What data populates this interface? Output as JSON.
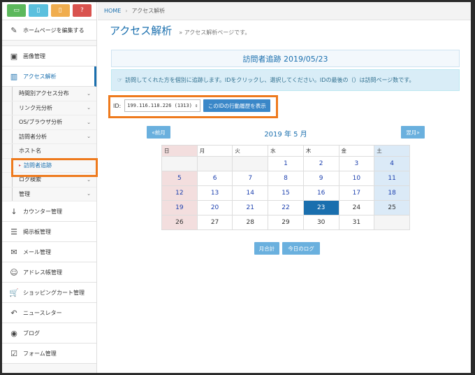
{
  "top_icons": [
    {
      "name": "monitor-icon",
      "glyph": "▭"
    },
    {
      "name": "tablet-icon",
      "glyph": "▯"
    },
    {
      "name": "phone-icon",
      "glyph": "▯"
    },
    {
      "name": "help-icon",
      "glyph": "?"
    }
  ],
  "sidebar": {
    "edit_home": {
      "label": "ホームページを編集する",
      "icon": "✎"
    },
    "image_manage": {
      "label": "画像管理",
      "icon": "▣"
    },
    "access": {
      "label": "アクセス解析",
      "icon": "▥"
    },
    "access_sub": [
      {
        "label": "時間別アクセス分布",
        "chev": "⌄"
      },
      {
        "label": "リンク元分析",
        "chev": "⌄"
      },
      {
        "label": "OS/ブラウザ分析",
        "chev": "⌄"
      },
      {
        "label": "訪問者分析",
        "chev": "⌄"
      },
      {
        "label": "ホスト名",
        "chev": ""
      },
      {
        "label": "訪問者追跡",
        "chev": ""
      },
      {
        "label": "ログ検索",
        "chev": "⌄"
      },
      {
        "label": "管理",
        "chev": "⌄"
      }
    ],
    "items": [
      {
        "label": "カウンター管理",
        "icon": "↓"
      },
      {
        "label": "掲示板管理",
        "icon": "☰"
      },
      {
        "label": "メール管理",
        "icon": "✉"
      },
      {
        "label": "アドレス帳管理",
        "icon": "☺"
      },
      {
        "label": "ショッピングカート管理",
        "icon": "🛒"
      },
      {
        "label": "ニュースレター",
        "icon": "↶"
      },
      {
        "label": "ブログ",
        "icon": "◉"
      },
      {
        "label": "フォーム管理",
        "icon": "☑"
      }
    ]
  },
  "breadcrumb": {
    "home": "HOME",
    "sep": "›",
    "current": "アクセス解析"
  },
  "page": {
    "title": "アクセス解析",
    "subtitle": "» アクセス解析ページです。"
  },
  "panel_title": "訪問者追跡 2019/05/23",
  "info": {
    "icon": "☞",
    "text": "訪問してくれた方を個別に追跡します。IDをクリックし、選択してください。IDの最後の（）は訪問ページ数です。"
  },
  "id_select": {
    "label": "ID:",
    "value": "199.116.118.226 (1313)",
    "arrow": "⇕",
    "button": "このIDの行動履歴を表示"
  },
  "calendar": {
    "prev": "«前月",
    "next": "翌月»",
    "title": "2019 年  5 月",
    "weekdays": [
      "日",
      "月",
      "火",
      "水",
      "木",
      "金",
      "土"
    ],
    "weeks": [
      [
        "",
        "",
        "",
        "1",
        "2",
        "3",
        "4"
      ],
      [
        "5",
        "6",
        "7",
        "8",
        "9",
        "10",
        "11"
      ],
      [
        "12",
        "13",
        "14",
        "15",
        "16",
        "17",
        "18"
      ],
      [
        "19",
        "20",
        "21",
        "22",
        "23",
        "24",
        "25"
      ],
      [
        "26",
        "27",
        "28",
        "29",
        "30",
        "31",
        ""
      ]
    ],
    "today": "23"
  },
  "buttons": {
    "monthly": "月合計",
    "today_log": "今日のログ"
  },
  "colors": {
    "accent": "#1a6fae",
    "highlight": "#ee7a1d"
  }
}
